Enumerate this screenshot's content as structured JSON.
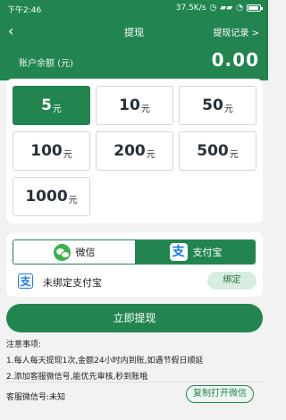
{
  "status_bar": {
    "time": "下午2:46",
    "network_speed": "37.5K/s",
    "icons": [
      "alarm-icon",
      "signal-icon",
      "wifi-icon",
      "battery-icon"
    ]
  },
  "header": {
    "title": "提现",
    "record_label": "提现记录 >",
    "balance_label": "账户余额 (元)",
    "balance_value": "0.00"
  },
  "amounts": [
    {
      "value": "5",
      "unit": "元",
      "selected": true
    },
    {
      "value": "10",
      "unit": "元",
      "selected": false
    },
    {
      "value": "50",
      "unit": "元",
      "selected": false
    },
    {
      "value": "100",
      "unit": "元",
      "selected": false
    },
    {
      "value": "200",
      "unit": "元",
      "selected": false
    },
    {
      "value": "500",
      "unit": "元",
      "selected": false
    },
    {
      "value": "1000",
      "unit": "元",
      "selected": false
    }
  ],
  "payment": {
    "tabs": [
      {
        "label": "微信",
        "icon": "wechat-icon",
        "selected": false
      },
      {
        "label": "支付宝",
        "icon": "alipay-icon",
        "selected": true
      }
    ],
    "unbound_text": "未绑定支付宝",
    "bind_label": "绑定"
  },
  "submit_label": "立即提现",
  "notes": {
    "title": "注意事项:",
    "items": [
      "1.每人每天提现1次,金额24小时内到账,如遇节假日顺延",
      "2.添加客服微信号,能优先审核,秒到账哦"
    ]
  },
  "service": {
    "label": "客服微信号:未知",
    "copy_label": "复制打开微信"
  },
  "colors": {
    "primary": "#22854f",
    "background": "#f2f2f2"
  }
}
